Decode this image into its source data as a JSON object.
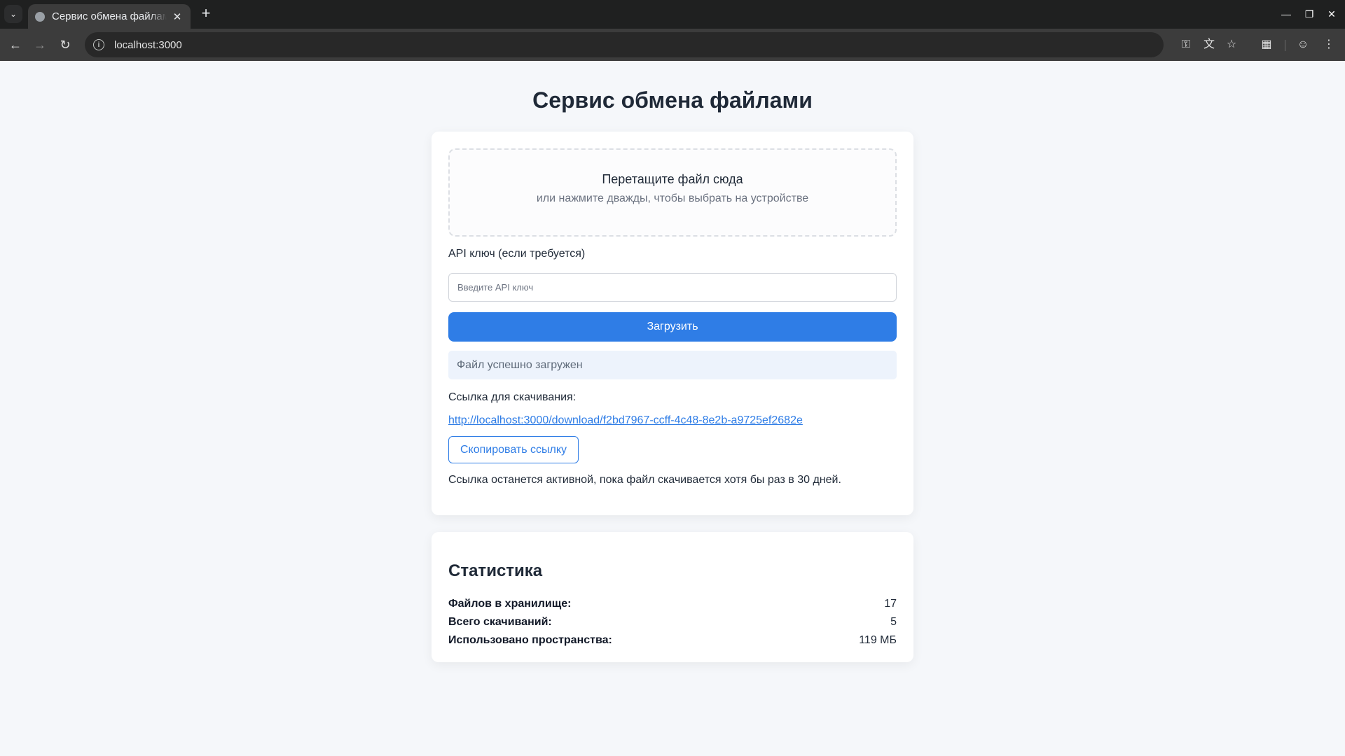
{
  "browser": {
    "tab_title": "Сервис обмена файлами",
    "url": "localhost:3000"
  },
  "page": {
    "title": "Сервис обмена файлами"
  },
  "upload": {
    "dropzone_title": "Перетащите файл сюда",
    "dropzone_subtitle": "или нажмите дважды, чтобы выбрать на устройстве",
    "api_label": "API ключ (если требуется)",
    "api_value": "",
    "api_placeholder": "Введите API ключ",
    "upload_button": "Загрузить",
    "status_message": "Файл успешно загружен",
    "link_label": "Ссылка для скачивания:",
    "download_link": "http://localhost:3000/download/f2bd7967-ccff-4c48-8e2b-a9725ef2682e",
    "copy_button": "Скопировать ссылку",
    "note": "Ссылка останется активной, пока файл скачивается хотя бы раз в 30 дней."
  },
  "stats": {
    "title": "Статистика",
    "rows": [
      {
        "label": "Файлов в хранилище:",
        "value": "17"
      },
      {
        "label": "Всего скачиваний:",
        "value": "5"
      },
      {
        "label": "Использовано пространства:",
        "value": "119 МБ"
      }
    ]
  },
  "colors": {
    "accent": "#2f7de6",
    "page_background": "#f5f7fa",
    "status_background": "#edf3fc"
  }
}
